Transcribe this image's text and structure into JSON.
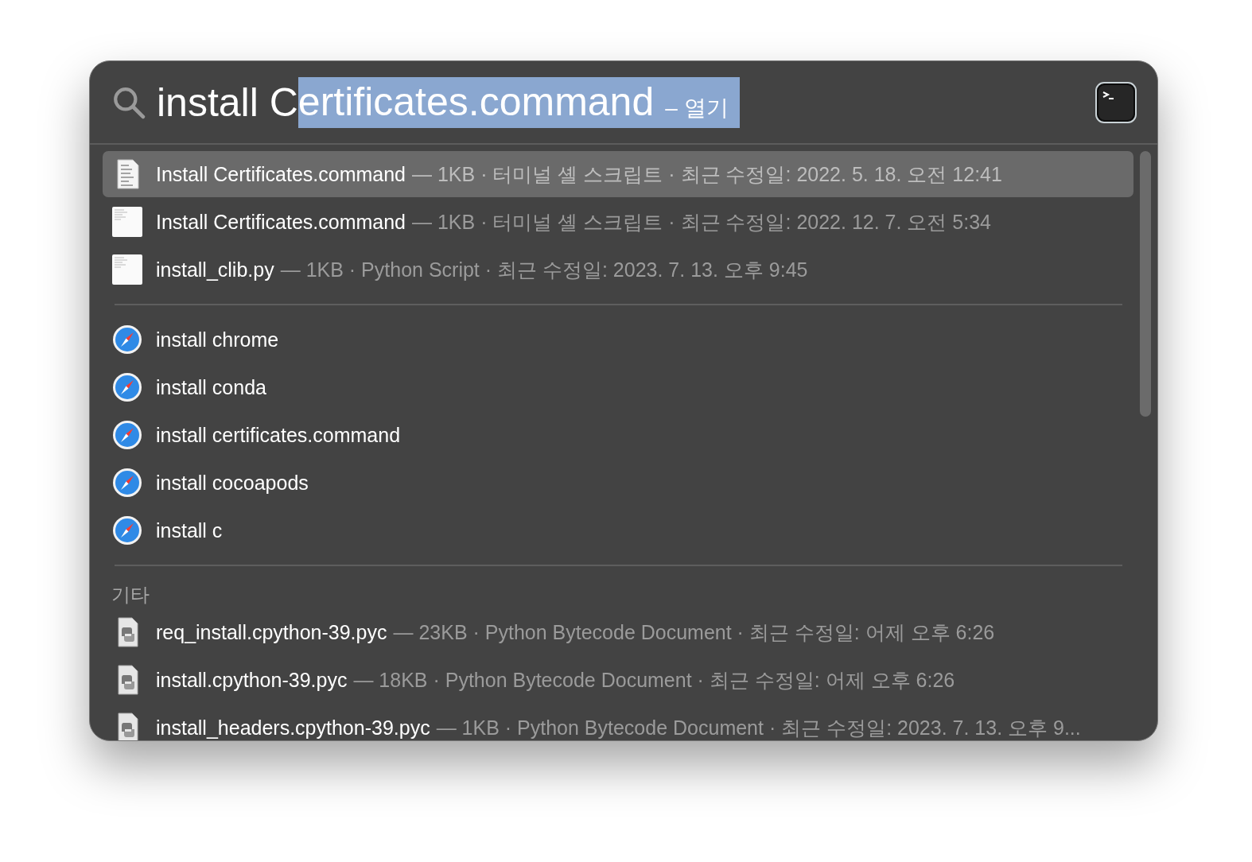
{
  "search": {
    "typed": "install C",
    "completion": "ertificates.command",
    "action": "– 열기"
  },
  "sections": [
    {
      "items": [
        {
          "kind": "script",
          "name": "Install Certificates.command",
          "detail": "— 1KB · 터미널 셸 스크립트 · 최근 수정일: 2022. 5. 18. 오전 12:41",
          "selected": true
        },
        {
          "kind": "document",
          "name": "Install Certificates.command",
          "detail": "— 1KB · 터미널 셸 스크립트 · 최근 수정일: 2022. 12. 7. 오전 5:34",
          "selected": false
        },
        {
          "kind": "document",
          "name": "install_clib.py",
          "detail": "— 1KB · Python Script · 최근 수정일: 2023. 7. 13. 오후 9:45",
          "selected": false
        }
      ]
    },
    {
      "items": [
        {
          "kind": "web",
          "name": "install chrome",
          "selected": false
        },
        {
          "kind": "web",
          "name": "install conda",
          "selected": false
        },
        {
          "kind": "web",
          "name": "install certificates.command",
          "selected": false
        },
        {
          "kind": "web",
          "name": "install cocoapods",
          "selected": false
        },
        {
          "kind": "web",
          "name": "install c",
          "selected": false
        }
      ]
    },
    {
      "title": "기타",
      "items": [
        {
          "kind": "python",
          "name": "req_install.cpython-39.pyc",
          "detail": "— 23KB · Python Bytecode Document · 최근 수정일: 어제 오후 6:26",
          "selected": false
        },
        {
          "kind": "python",
          "name": "install.cpython-39.pyc",
          "detail": "— 18KB · Python Bytecode Document · 최근 수정일: 어제 오후 6:26",
          "selected": false
        },
        {
          "kind": "python",
          "name": "install_headers.cpython-39.pyc",
          "detail": "— 1KB · Python Bytecode Document · 최근 수정일: 2023. 7. 13. 오후 9...",
          "selected": false
        }
      ]
    }
  ]
}
